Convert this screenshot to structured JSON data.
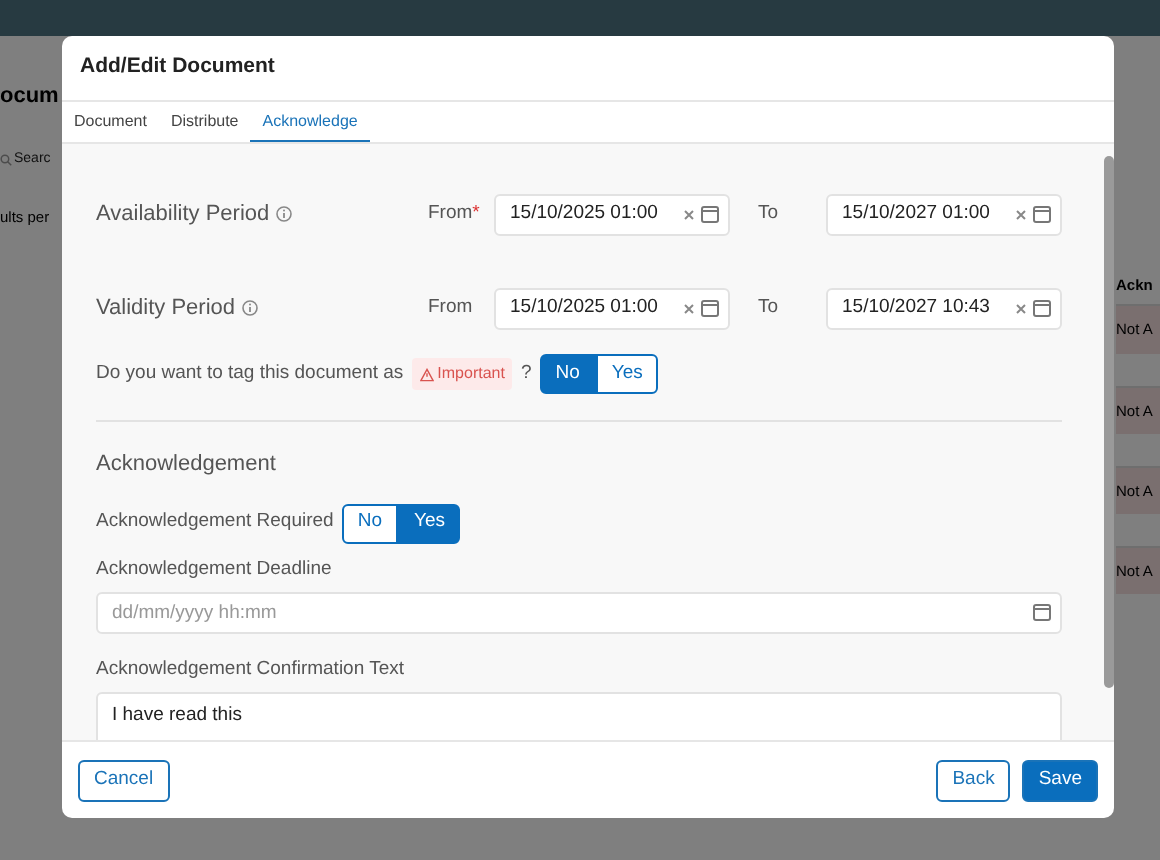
{
  "background": {
    "heading": "ocum",
    "search_placeholder": "Searc",
    "results_label": "ults per",
    "column_header": "Ackn",
    "cells": [
      "Not A",
      "Not A",
      "Not A",
      "Not A"
    ]
  },
  "modal": {
    "title": "Add/Edit Document",
    "tabs": [
      {
        "label": "Document",
        "selected": false
      },
      {
        "label": "Distribute",
        "selected": false
      },
      {
        "label": "Acknowledge",
        "selected": true
      }
    ],
    "periods": [
      {
        "label": "Availability Period",
        "from_label": "From",
        "required_mark": "*",
        "from": "15/10/2025 01:00",
        "to_label": "To",
        "to": "15/10/2027 01:00"
      },
      {
        "label": "Validity Period",
        "from_label": "From",
        "from": "15/10/2025 01:00",
        "to_label": "To",
        "to": "15/10/2027 10:43"
      }
    ],
    "tag_question": {
      "prefix": "Do you want to tag this document as",
      "tag": "Important",
      "suffix": "?",
      "options": [
        {
          "label": "No",
          "selected": true
        },
        {
          "label": "Yes",
          "selected": false
        }
      ]
    },
    "section_title": "Acknowledgement",
    "ack_required": {
      "label": "Acknowledgement Required",
      "options": [
        {
          "label": "No",
          "selected": false
        },
        {
          "label": "Yes",
          "selected": true
        }
      ]
    },
    "deadline": {
      "label": "Acknowledgement Deadline",
      "placeholder": "dd/mm/yyyy hh:mm"
    },
    "confirmation": {
      "label": "Acknowledgement Confirmation Text",
      "value": "I have read this"
    },
    "footer": {
      "cancel": "Cancel",
      "back": "Back",
      "save": "Save"
    }
  }
}
